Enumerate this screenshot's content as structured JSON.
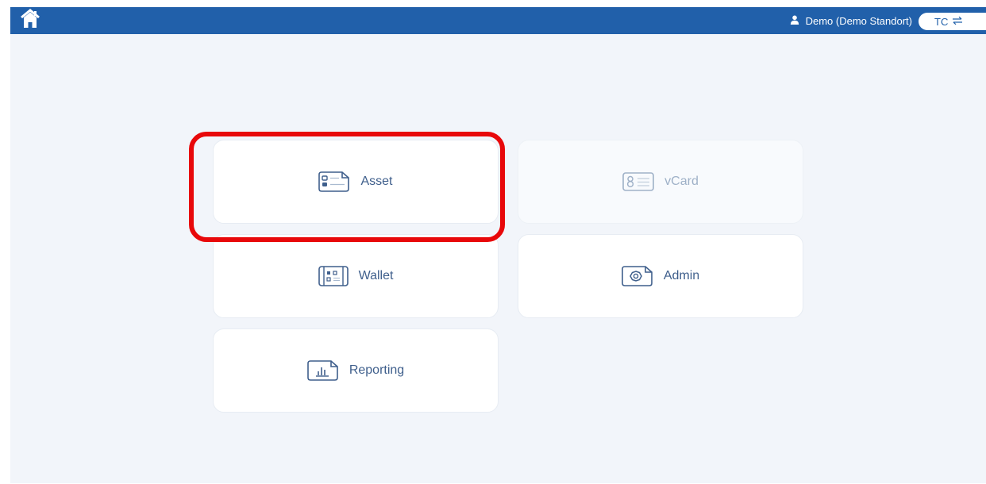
{
  "header": {
    "user_label": "Demo (Demo Standort)",
    "tc_label": "TC"
  },
  "tiles": [
    {
      "label": "Asset",
      "icon": "asset-card-icon",
      "enabled": true
    },
    {
      "label": "vCard",
      "icon": "vcard-icon",
      "enabled": false
    },
    {
      "label": "Wallet",
      "icon": "wallet-icon",
      "enabled": true
    },
    {
      "label": "Admin",
      "icon": "admin-gear-icon",
      "enabled": true
    },
    {
      "label": "Reporting",
      "icon": "reporting-chart-icon",
      "enabled": true
    }
  ],
  "colors": {
    "topbar": "#2160aa",
    "background": "#f2f5fa",
    "tile_text": "#3f5f8c",
    "tile_disabled_text": "#9fb1c8",
    "highlight": "#e8080a"
  }
}
